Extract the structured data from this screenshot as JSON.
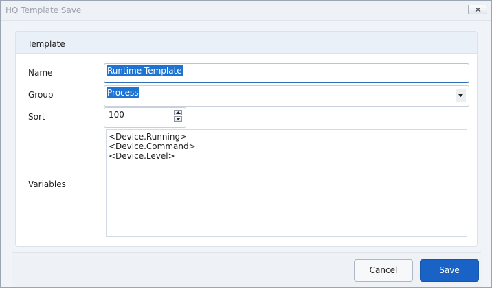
{
  "window": {
    "title": "HQ Template Save"
  },
  "panel": {
    "title": "Template"
  },
  "form": {
    "name_label": "Name",
    "name_value": "Runtime Template",
    "group_label": "Group",
    "group_value": "Process",
    "sort_label": "Sort",
    "sort_value": "100",
    "variables_label": "Variables",
    "variables": [
      "<Device.Running>",
      "<Device.Command>",
      "<Device.Level>"
    ]
  },
  "buttons": {
    "cancel": "Cancel",
    "save": "Save"
  },
  "colors": {
    "accent": "#1a63c6",
    "selection": "#1e74d2"
  },
  "icons": {
    "close": "close-icon",
    "dropdown": "chevron-down-icon",
    "spin_up": "spin-up-icon",
    "spin_down": "spin-down-icon"
  }
}
